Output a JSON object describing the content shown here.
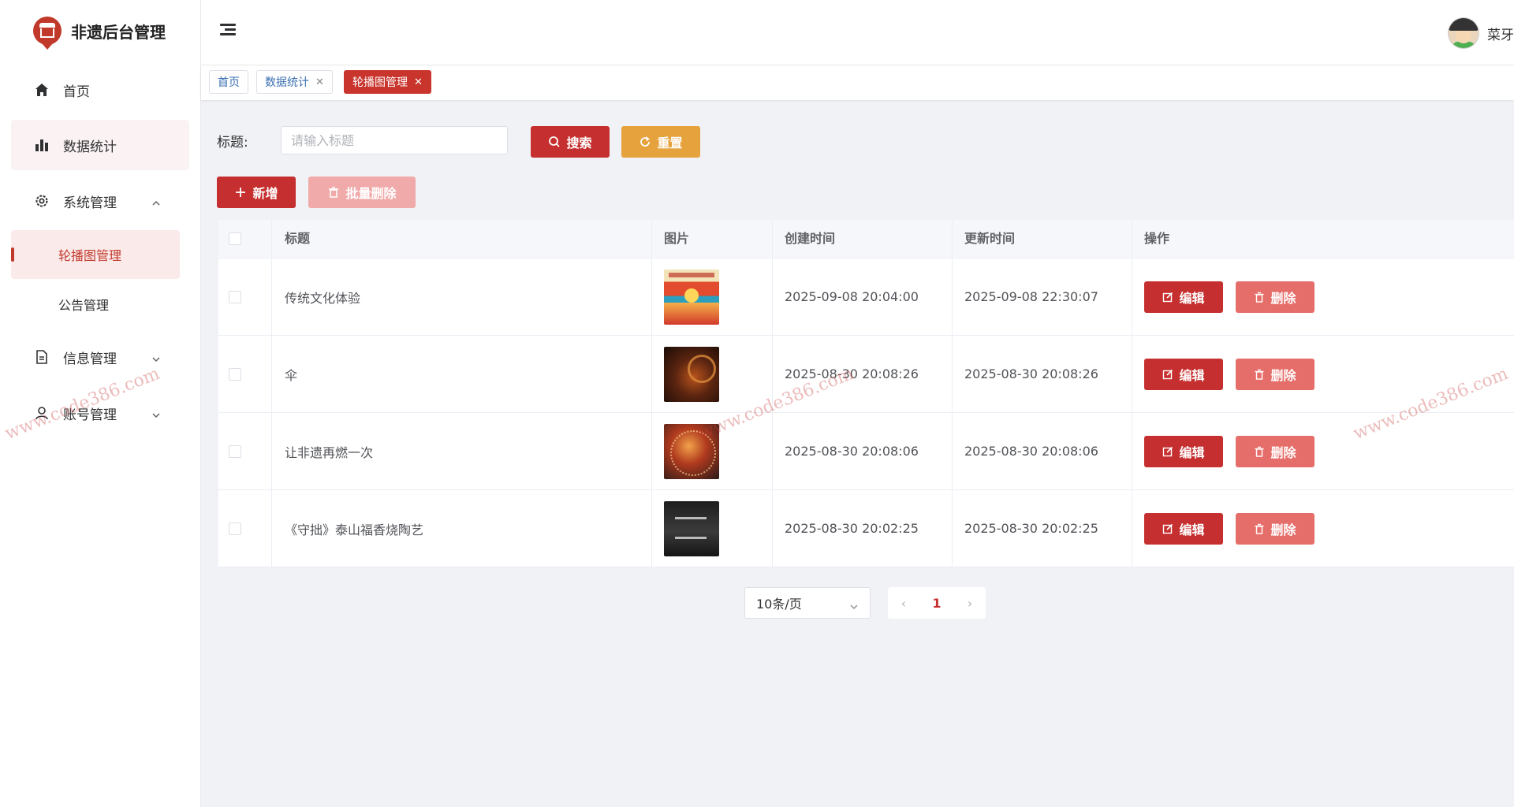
{
  "app": {
    "title": "非遗后台管理"
  },
  "sidebar": {
    "items": [
      {
        "label": "首页",
        "icon": "home-icon"
      },
      {
        "label": "数据统计",
        "icon": "bar-chart-icon"
      },
      {
        "label": "系统管理",
        "icon": "gear-icon",
        "expanded": true,
        "children": [
          {
            "label": "轮播图管理",
            "active": true
          },
          {
            "label": "公告管理"
          }
        ]
      },
      {
        "label": "信息管理",
        "icon": "document-icon",
        "expanded": false
      },
      {
        "label": "账号管理",
        "icon": "user-icon",
        "expanded": false
      }
    ]
  },
  "header": {
    "user_name": "菜牙"
  },
  "tabs": [
    {
      "label": "首页",
      "closable": false
    },
    {
      "label": "数据统计",
      "closable": true
    },
    {
      "label": "轮播图管理",
      "closable": true,
      "active": true
    }
  ],
  "search": {
    "label": "标题:",
    "placeholder": "请输入标题",
    "search_button": "搜索",
    "reset_button": "重置"
  },
  "actions": {
    "add_button": "新增",
    "batch_delete_button": "批量删除"
  },
  "table": {
    "columns": [
      "标题",
      "图片",
      "创建时间",
      "更新时间",
      "操作"
    ],
    "edit_label": "编辑",
    "delete_label": "删除",
    "rows": [
      {
        "title": "传统文化体验",
        "image": "banner-culture-thumbnail",
        "created": "2025-09-08 20:04:00",
        "updated": "2025-09-08 22:30:07"
      },
      {
        "title": "伞",
        "image": "banner-umbrella-thumbnail",
        "created": "2025-08-30 20:08:26",
        "updated": "2025-08-30 20:08:26"
      },
      {
        "title": "让非遗再燃一次",
        "image": "banner-fireworks-thumbnail",
        "created": "2025-08-30 20:08:06",
        "updated": "2025-08-30 20:08:06"
      },
      {
        "title": "《守拙》泰山福香烧陶艺",
        "image": "banner-pottery-thumbnail",
        "created": "2025-08-30 20:02:25",
        "updated": "2025-08-30 20:02:25"
      }
    ]
  },
  "pagination": {
    "page_size_label": "10条/页",
    "current_page": "1"
  },
  "watermark": {
    "text": "www.code386.com"
  },
  "colors": {
    "primary": "#c62f2f",
    "warning": "#e6a23c",
    "danger_light": "#e66e6a",
    "disabled": "#f1aaaa"
  }
}
